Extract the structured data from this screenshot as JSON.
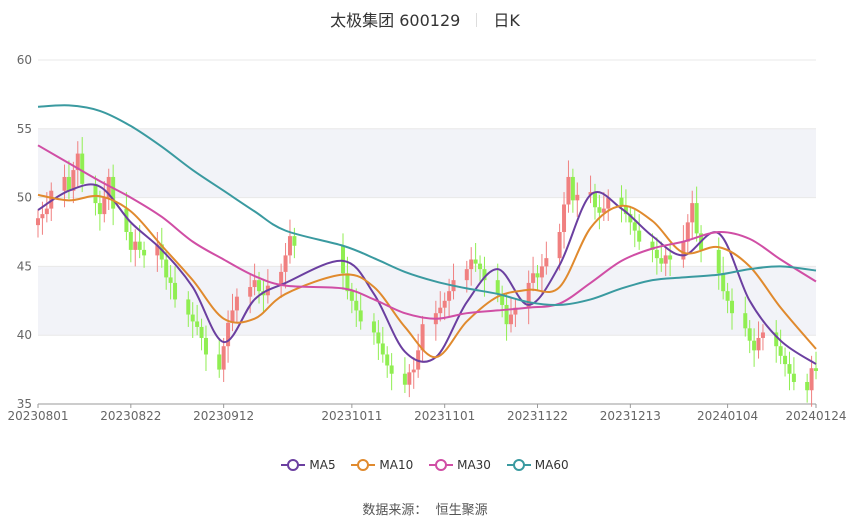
{
  "header": {
    "name_code": "太极集团 600129",
    "period": "日K"
  },
  "source": {
    "label": "数据来源：",
    "provider": "恒生聚源"
  },
  "colors": {
    "up": "#f08080",
    "down": "#90ee52",
    "MA5": "#6b3fa0",
    "MA10": "#e08a2e",
    "MA30": "#d04ea5",
    "MA60": "#3a9aa0",
    "band": "#f2f3f8",
    "grid": "#e8e8e8"
  },
  "chart_data": {
    "type": "candlestick",
    "title": "太极集团 600129",
    "subtitle": "日K",
    "ylim": [
      35,
      60
    ],
    "y_ticks": [
      35,
      40,
      45,
      50,
      55,
      60
    ],
    "x_tick_labels": [
      "20230801",
      "20230822",
      "20230912",
      "20231011",
      "20231101",
      "20231122",
      "20231213",
      "20240104",
      "20240124"
    ],
    "x_tick_dates": [
      "2023-08-01",
      "2023-08-22",
      "2023-09-12",
      "2023-10-11",
      "2023-11-01",
      "2023-11-22",
      "2023-12-13",
      "2024-01-04",
      "2024-01-24"
    ],
    "close": [
      [
        "2023-08-01",
        48.5
      ],
      [
        "2023-08-02",
        48.8
      ],
      [
        "2023-08-03",
        49.2
      ],
      [
        "2023-08-04",
        50.5
      ],
      [
        "2023-08-07",
        51.5
      ],
      [
        "2023-08-08",
        50.5
      ],
      [
        "2023-08-09",
        52.0
      ],
      [
        "2023-08-10",
        53.2
      ],
      [
        "2023-08-11",
        51.0
      ],
      [
        "2023-08-14",
        49.6
      ],
      [
        "2023-08-15",
        48.8
      ],
      [
        "2023-08-16",
        50.0
      ],
      [
        "2023-08-17",
        51.5
      ],
      [
        "2023-08-18",
        49.2
      ],
      [
        "2023-08-21",
        47.5
      ],
      [
        "2023-08-22",
        46.2
      ],
      [
        "2023-08-23",
        46.8
      ],
      [
        "2023-08-24",
        46.2
      ],
      [
        "2023-08-25",
        45.8
      ],
      [
        "2023-08-28",
        46.6
      ],
      [
        "2023-08-29",
        45.5
      ],
      [
        "2023-08-30",
        44.2
      ],
      [
        "2023-08-31",
        43.8
      ],
      [
        "2023-09-01",
        42.6
      ],
      [
        "2023-09-04",
        41.5
      ],
      [
        "2023-09-05",
        41.0
      ],
      [
        "2023-09-06",
        40.6
      ],
      [
        "2023-09-07",
        39.8
      ],
      [
        "2023-09-08",
        38.6
      ],
      [
        "2023-09-11",
        37.5
      ],
      [
        "2023-09-12",
        39.2
      ],
      [
        "2023-09-13",
        40.9
      ],
      [
        "2023-09-14",
        41.8
      ],
      [
        "2023-09-15",
        42.8
      ],
      [
        "2023-09-18",
        43.5
      ],
      [
        "2023-09-19",
        44.0
      ],
      [
        "2023-09-20",
        43.2
      ],
      [
        "2023-09-21",
        42.9
      ],
      [
        "2023-09-22",
        43.6
      ],
      [
        "2023-09-25",
        44.6
      ],
      [
        "2023-09-26",
        45.8
      ],
      [
        "2023-09-27",
        47.2
      ],
      [
        "2023-09-28",
        46.5
      ],
      [
        "2023-10-09",
        44.5
      ],
      [
        "2023-10-10",
        43.2
      ],
      [
        "2023-10-11",
        42.5
      ],
      [
        "2023-10-12",
        41.8
      ],
      [
        "2023-10-13",
        41.0
      ],
      [
        "2023-10-16",
        40.2
      ],
      [
        "2023-10-17",
        39.4
      ],
      [
        "2023-10-18",
        38.6
      ],
      [
        "2023-10-19",
        37.8
      ],
      [
        "2023-10-20",
        37.2
      ],
      [
        "2023-10-23",
        36.4
      ],
      [
        "2023-10-24",
        37.3
      ],
      [
        "2023-10-25",
        37.5
      ],
      [
        "2023-10-26",
        38.9
      ],
      [
        "2023-10-27",
        40.8
      ],
      [
        "2023-10-30",
        41.6
      ],
      [
        "2023-10-31",
        42.0
      ],
      [
        "2023-11-01",
        42.5
      ],
      [
        "2023-11-02",
        43.2
      ],
      [
        "2023-11-03",
        44.0
      ],
      [
        "2023-11-06",
        44.8
      ],
      [
        "2023-11-07",
        45.5
      ],
      [
        "2023-11-08",
        45.2
      ],
      [
        "2023-11-09",
        44.8
      ],
      [
        "2023-11-10",
        44.0
      ],
      [
        "2023-11-13",
        43.0
      ],
      [
        "2023-11-14",
        42.2
      ],
      [
        "2023-11-15",
        40.8
      ],
      [
        "2023-11-16",
        41.5
      ],
      [
        "2023-11-17",
        42.0
      ],
      [
        "2023-11-20",
        43.8
      ],
      [
        "2023-11-21",
        44.5
      ],
      [
        "2023-11-22",
        44.2
      ],
      [
        "2023-11-23",
        45.0
      ],
      [
        "2023-11-24",
        45.6
      ],
      [
        "2023-11-27",
        47.5
      ],
      [
        "2023-11-28",
        49.5
      ],
      [
        "2023-11-29",
        51.5
      ],
      [
        "2023-11-30",
        49.8
      ],
      [
        "2023-12-01",
        50.2
      ],
      [
        "2023-12-04",
        50.4
      ],
      [
        "2023-12-05",
        49.3
      ],
      [
        "2023-12-06",
        48.9
      ],
      [
        "2023-12-07",
        49.2
      ],
      [
        "2023-12-08",
        50.0
      ],
      [
        "2023-12-11",
        49.4
      ],
      [
        "2023-12-12",
        48.8
      ],
      [
        "2023-12-13",
        48.2
      ],
      [
        "2023-12-14",
        47.6
      ],
      [
        "2023-12-15",
        46.8
      ],
      [
        "2023-12-18",
        46.2
      ],
      [
        "2023-12-19",
        45.6
      ],
      [
        "2023-12-20",
        45.2
      ],
      [
        "2023-12-21",
        45.8
      ],
      [
        "2023-12-22",
        45.5
      ],
      [
        "2023-12-25",
        46.8
      ],
      [
        "2023-12-26",
        48.2
      ],
      [
        "2023-12-27",
        49.6
      ],
      [
        "2023-12-28",
        47.4
      ],
      [
        "2023-12-29",
        46.2
      ],
      [
        "2024-01-02",
        44.5
      ],
      [
        "2024-01-03",
        43.2
      ],
      [
        "2024-01-04",
        42.5
      ],
      [
        "2024-01-05",
        41.6
      ],
      [
        "2024-01-08",
        40.5
      ],
      [
        "2024-01-09",
        39.6
      ],
      [
        "2024-01-10",
        38.9
      ],
      [
        "2024-01-11",
        39.8
      ],
      [
        "2024-01-12",
        40.2
      ],
      [
        "2024-01-15",
        39.2
      ],
      [
        "2024-01-16",
        38.5
      ],
      [
        "2024-01-17",
        37.9
      ],
      [
        "2024-01-18",
        37.2
      ],
      [
        "2024-01-19",
        36.6
      ],
      [
        "2024-01-22",
        36.0
      ],
      [
        "2024-01-23",
        37.6
      ],
      [
        "2024-01-24",
        37.4
      ]
    ],
    "series": [
      {
        "name": "MA5",
        "color": "#6b3fa0",
        "points": [
          [
            "2023-08-01",
            49.1
          ],
          [
            "2023-08-08",
            50.5
          ],
          [
            "2023-08-15",
            50.8
          ],
          [
            "2023-08-22",
            48.2
          ],
          [
            "2023-08-29",
            46.2
          ],
          [
            "2023-09-05",
            43.5
          ],
          [
            "2023-09-12",
            39.5
          ],
          [
            "2023-09-19",
            42.6
          ],
          [
            "2023-09-26",
            43.8
          ],
          [
            "2023-10-09",
            45.4
          ],
          [
            "2023-10-16",
            43.0
          ],
          [
            "2023-10-23",
            38.8
          ],
          [
            "2023-10-30",
            38.4
          ],
          [
            "2023-11-06",
            42.4
          ],
          [
            "2023-11-13",
            44.8
          ],
          [
            "2023-11-20",
            42.2
          ],
          [
            "2023-11-27",
            45.1
          ],
          [
            "2023-12-04",
            50.2
          ],
          [
            "2023-12-11",
            49.2
          ],
          [
            "2023-12-18",
            47.2
          ],
          [
            "2023-12-25",
            45.8
          ],
          [
            "2024-01-02",
            47.4
          ],
          [
            "2024-01-09",
            42.5
          ],
          [
            "2024-01-16",
            39.6
          ],
          [
            "2024-01-24",
            37.9
          ]
        ]
      },
      {
        "name": "MA10",
        "color": "#e08a2e",
        "points": [
          [
            "2023-08-01",
            50.2
          ],
          [
            "2023-08-08",
            49.8
          ],
          [
            "2023-08-15",
            50.1
          ],
          [
            "2023-08-22",
            49.0
          ],
          [
            "2023-08-29",
            46.5
          ],
          [
            "2023-09-05",
            44.0
          ],
          [
            "2023-09-12",
            41.2
          ],
          [
            "2023-09-19",
            41.2
          ],
          [
            "2023-09-26",
            43.0
          ],
          [
            "2023-10-09",
            44.4
          ],
          [
            "2023-10-16",
            43.5
          ],
          [
            "2023-10-23",
            40.6
          ],
          [
            "2023-10-30",
            38.4
          ],
          [
            "2023-11-06",
            41.0
          ],
          [
            "2023-11-13",
            42.8
          ],
          [
            "2023-11-20",
            43.3
          ],
          [
            "2023-11-27",
            43.5
          ],
          [
            "2023-12-04",
            47.8
          ],
          [
            "2023-12-11",
            49.4
          ],
          [
            "2023-12-18",
            48.3
          ],
          [
            "2023-12-25",
            46.0
          ],
          [
            "2024-01-02",
            46.4
          ],
          [
            "2024-01-09",
            45.0
          ],
          [
            "2024-01-16",
            42.0
          ],
          [
            "2024-01-24",
            39.0
          ]
        ]
      },
      {
        "name": "MA30",
        "color": "#d04ea5",
        "points": [
          [
            "2023-08-01",
            53.8
          ],
          [
            "2023-08-08",
            52.5
          ],
          [
            "2023-08-15",
            51.2
          ],
          [
            "2023-08-22",
            50.0
          ],
          [
            "2023-08-29",
            48.6
          ],
          [
            "2023-09-05",
            46.8
          ],
          [
            "2023-09-12",
            45.5
          ],
          [
            "2023-09-19",
            44.3
          ],
          [
            "2023-09-26",
            43.6
          ],
          [
            "2023-10-09",
            43.4
          ],
          [
            "2023-10-16",
            42.6
          ],
          [
            "2023-10-23",
            41.6
          ],
          [
            "2023-10-30",
            41.2
          ],
          [
            "2023-11-06",
            41.6
          ],
          [
            "2023-11-13",
            41.8
          ],
          [
            "2023-11-20",
            42.0
          ],
          [
            "2023-11-27",
            42.3
          ],
          [
            "2023-12-04",
            43.8
          ],
          [
            "2023-12-11",
            45.4
          ],
          [
            "2023-12-18",
            46.3
          ],
          [
            "2023-12-25",
            46.8
          ],
          [
            "2024-01-02",
            47.5
          ],
          [
            "2024-01-09",
            47.0
          ],
          [
            "2024-01-16",
            45.5
          ],
          [
            "2024-01-24",
            43.9
          ]
        ]
      },
      {
        "name": "MA60",
        "color": "#3a9aa0",
        "points": [
          [
            "2023-08-01",
            56.6
          ],
          [
            "2023-08-08",
            56.7
          ],
          [
            "2023-08-15",
            56.3
          ],
          [
            "2023-08-22",
            55.2
          ],
          [
            "2023-08-29",
            53.7
          ],
          [
            "2023-09-05",
            52.0
          ],
          [
            "2023-09-12",
            50.5
          ],
          [
            "2023-09-19",
            49.0
          ],
          [
            "2023-09-26",
            47.6
          ],
          [
            "2023-10-09",
            46.5
          ],
          [
            "2023-10-16",
            45.6
          ],
          [
            "2023-10-23",
            44.6
          ],
          [
            "2023-10-30",
            43.9
          ],
          [
            "2023-11-06",
            43.4
          ],
          [
            "2023-11-13",
            43.0
          ],
          [
            "2023-11-20",
            42.4
          ],
          [
            "2023-11-27",
            42.2
          ],
          [
            "2023-12-04",
            42.6
          ],
          [
            "2023-12-11",
            43.4
          ],
          [
            "2023-12-18",
            44.0
          ],
          [
            "2023-12-25",
            44.2
          ],
          [
            "2024-01-02",
            44.4
          ],
          [
            "2024-01-09",
            44.8
          ],
          [
            "2024-01-16",
            45.0
          ],
          [
            "2024-01-24",
            44.7
          ]
        ]
      }
    ],
    "legend": [
      "MA5",
      "MA10",
      "MA30",
      "MA60"
    ],
    "legend_position": "bottom-center",
    "grid": true
  }
}
